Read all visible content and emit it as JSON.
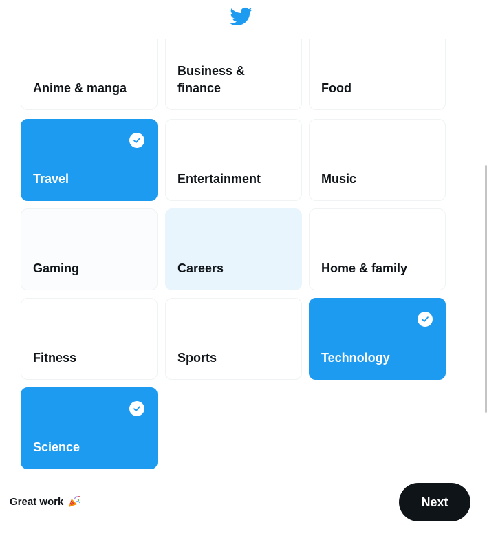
{
  "header": {
    "logo_icon": "twitter-bird-icon",
    "brand_color": "#1d9bf0"
  },
  "topics": [
    {
      "label": "Anime & manga",
      "selected": false
    },
    {
      "label": "Business & finance",
      "selected": false
    },
    {
      "label": "Food",
      "selected": false
    },
    {
      "label": "Travel",
      "selected": true
    },
    {
      "label": "Entertainment",
      "selected": false
    },
    {
      "label": "Music",
      "selected": false
    },
    {
      "label": "Gaming",
      "selected": false
    },
    {
      "label": "Careers",
      "selected": false,
      "hovered": true
    },
    {
      "label": "Home & family",
      "selected": false
    },
    {
      "label": "Fitness",
      "selected": false
    },
    {
      "label": "Sports",
      "selected": false
    },
    {
      "label": "Technology",
      "selected": true
    },
    {
      "label": "Science",
      "selected": true
    }
  ],
  "footer": {
    "message": "Great work",
    "message_icon": "party-popper-icon",
    "next_label": "Next"
  },
  "colors": {
    "selected_bg": "#1d9bf0",
    "hover_bg": "#e8f5fd",
    "text": "#0f1419",
    "button_bg": "#0f1419"
  }
}
